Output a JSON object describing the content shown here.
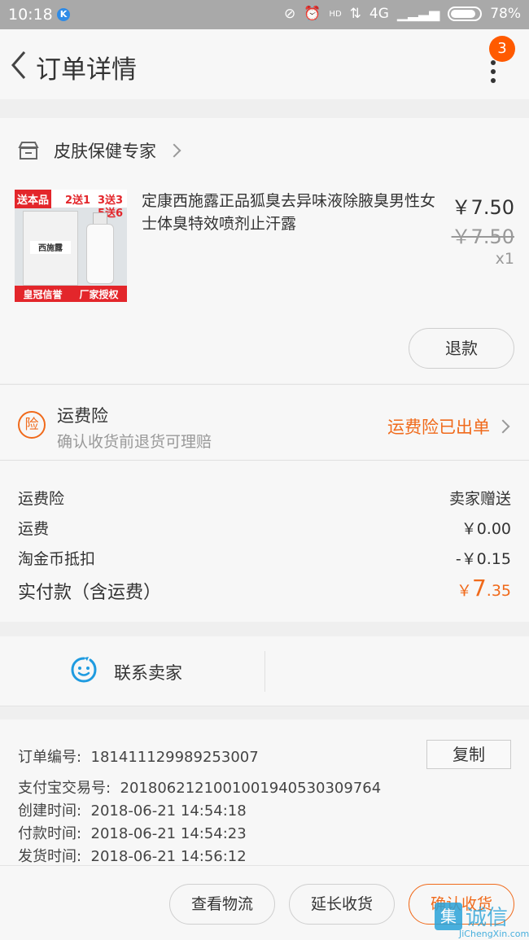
{
  "status_bar": {
    "time": "10:18",
    "app_badge": "K",
    "network_hd": "HD",
    "network_type": "4G",
    "battery": "78%"
  },
  "nav": {
    "title": "订单详情",
    "notification_count": "3"
  },
  "shop": {
    "name": "皮肤保健专家"
  },
  "product": {
    "image_text": {
      "tag_free": "送本品",
      "promo_a": "2送1",
      "promo_b": "3送3",
      "promo_c": "5送6",
      "box_name": "西施露",
      "banner_left": "皇冠信誉",
      "banner_right": "厂家授权"
    },
    "title": "定康西施露正品狐臭去异味液除腋臭男性女士体臭特效喷剂止汗露",
    "price": "￥7.50",
    "original_price": "￥7.50",
    "quantity": "x1",
    "refund_label": "退款"
  },
  "insurance": {
    "icon_char": "险",
    "title": "运费险",
    "subtitle": "确认收货前退货可理赔",
    "status": "运费险已出单"
  },
  "fees": [
    {
      "label": "运费险",
      "value": "卖家赠送"
    },
    {
      "label": "运费",
      "value": "￥0.00"
    },
    {
      "label": "淘金币抵扣",
      "value": "-￥0.15"
    }
  ],
  "total": {
    "label": "实付款（含运费）",
    "currency": "￥",
    "integer": "7",
    "decimal": ".35"
  },
  "contact": {
    "label": "联系卖家"
  },
  "order_info": {
    "order_no_label": "订单编号:",
    "order_no": "181411129989253007",
    "copy_label": "复制",
    "alipay_label": "支付宝交易号:",
    "alipay_no": "2018062121001001940530309764",
    "created_label": "创建时间:",
    "created": "2018-06-21 14:54:18",
    "paid_label": "付款时间:",
    "paid": "2018-06-21 14:54:23",
    "shipped_label": "发货时间:",
    "shipped": "2018-06-21 14:56:12"
  },
  "actions": {
    "logistics": "查看物流",
    "extend": "延长收货",
    "confirm": "确认收货"
  },
  "watermark": {
    "icon_char": "集",
    "cn": "诚信",
    "en": "JiChengXin.com"
  }
}
